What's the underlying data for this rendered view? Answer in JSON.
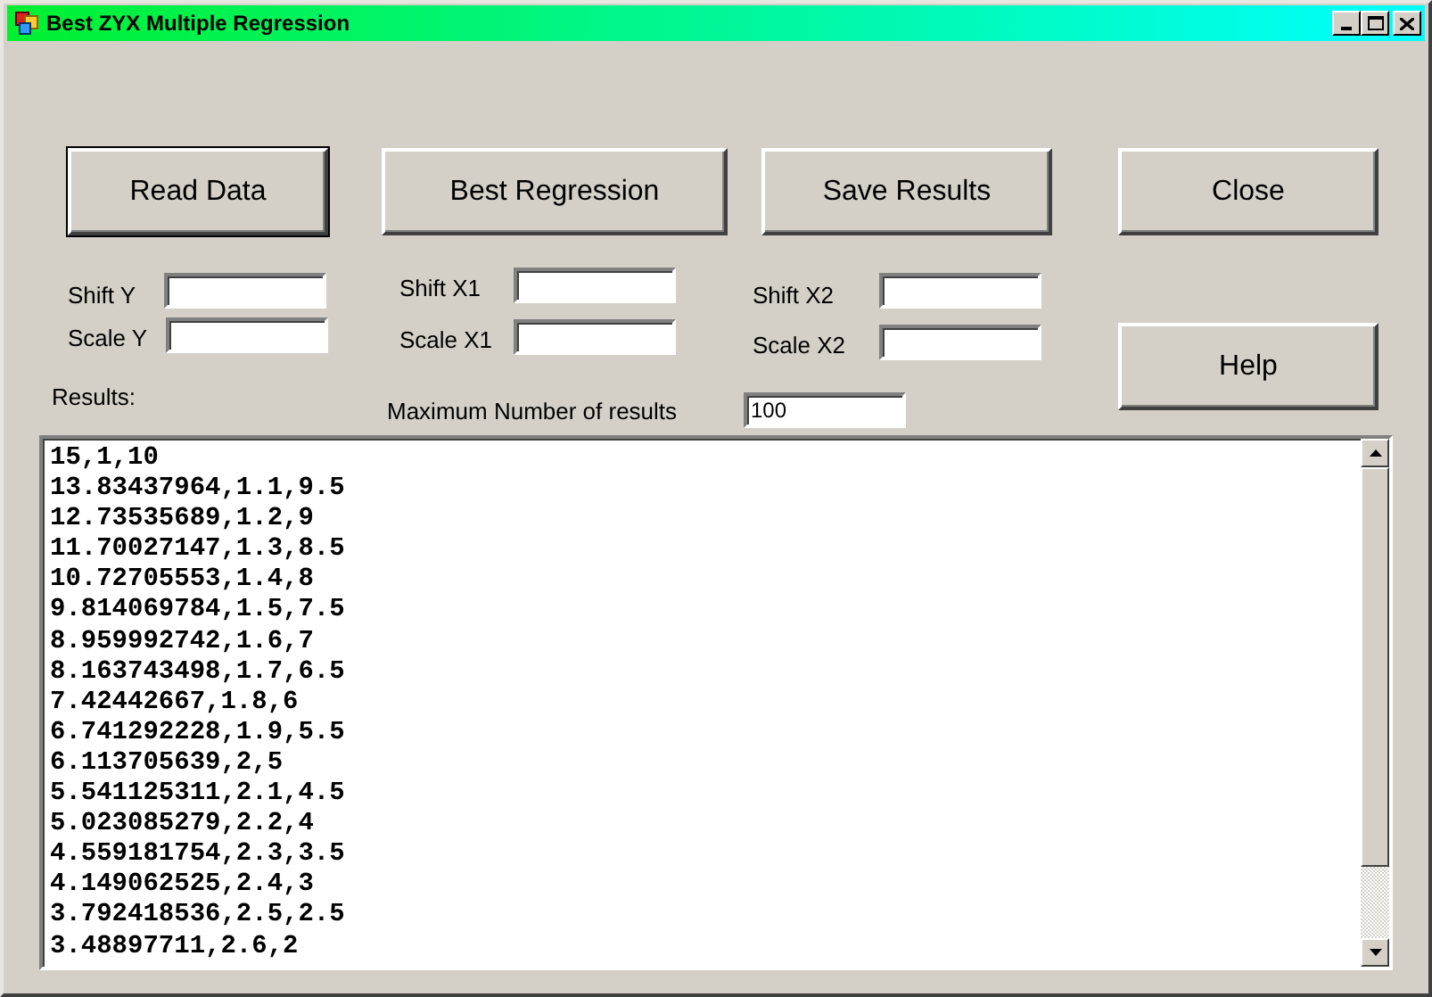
{
  "window": {
    "title": "Best ZYX Multiple Regression"
  },
  "buttons": [
    {
      "label": "Read Data",
      "kind": "read"
    },
    {
      "label": "Best Regression",
      "kind": "best"
    },
    {
      "label": "Save Results",
      "kind": "save"
    },
    {
      "label": "Close",
      "kind": "close"
    },
    {
      "label": "Help",
      "kind": "help"
    }
  ],
  "fields": [
    {
      "label": "Shift Y"
    },
    {
      "label": "Scale Y"
    },
    {
      "label": "Shift X1"
    },
    {
      "label": "Scale X1"
    },
    {
      "label": "Shift X2"
    },
    {
      "label": "Scale X2"
    }
  ],
  "results_label": "Results:",
  "max_results": {
    "label": "Maximum Number of results",
    "value": "100"
  },
  "results": [
    "15,1,10",
    "13.83437964,1.1,9.5",
    "12.73535689,1.2,9",
    "11.70027147,1.3,8.5",
    "10.72705553,1.4,8",
    "9.814069784,1.5,7.5",
    "8.959992742,1.6,7",
    "8.163743498,1.7,6.5",
    "7.42442667,1.8,6",
    "6.741292228,1.9,5.5",
    "6.113705639,2,5",
    "5.541125311,2.1,4.5",
    "5.023085279,2.2,4",
    "4.559181754,2.3,3.5",
    "4.149062525,2.4,3",
    "3.792418536,2.5,2.5",
    "3.48897711,2.6,2"
  ]
}
